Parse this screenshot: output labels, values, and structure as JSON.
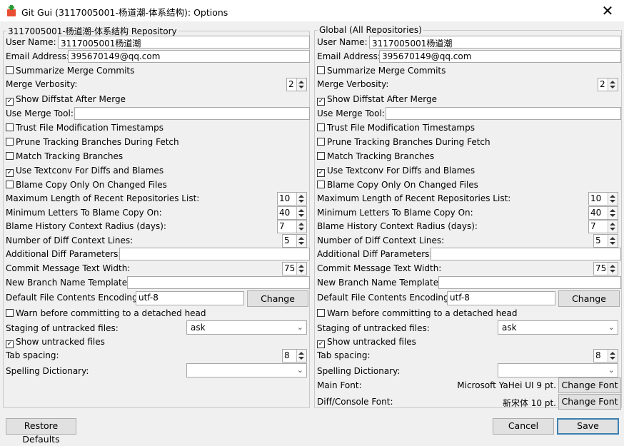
{
  "window": {
    "title": "Git Gui (3117005001-杨道潮-体系结构): Options",
    "close_glyph": "✕"
  },
  "local": {
    "legend": "3117005001-杨道潮-体系结构 Repository",
    "user_name_label": "User Name:",
    "user_name": "3117005001杨道潮",
    "email_label": "Email Address:",
    "email": "395670149@qq.com",
    "summarize_merge": "Summarize Merge Commits",
    "summarize_merge_checked": false,
    "merge_verbosity_label": "Merge Verbosity:",
    "merge_verbosity": "2",
    "show_diffstat": "Show Diffstat After Merge",
    "show_diffstat_checked": true,
    "merge_tool_label": "Use Merge Tool:",
    "merge_tool": "",
    "trust_mtime": "Trust File Modification Timestamps",
    "trust_mtime_checked": false,
    "prune_fetch": "Prune Tracking Branches During Fetch",
    "prune_fetch_checked": false,
    "match_tracking": "Match Tracking Branches",
    "match_tracking_checked": false,
    "textconv": "Use Textconv For Diffs and Blames",
    "textconv_checked": true,
    "blame_copy_changed": "Blame Copy Only On Changed Files",
    "blame_copy_changed_checked": false,
    "max_recent_label": "Maximum Length of Recent Repositories List:",
    "max_recent": "10",
    "min_blame_label": "Minimum Letters To Blame Copy On:",
    "min_blame": "40",
    "blame_radius_label": "Blame History Context Radius (days):",
    "blame_radius": "7",
    "diff_context_label": "Number of Diff Context Lines:",
    "diff_context": "5",
    "diff_params_label": "Additional Diff Parameters:",
    "diff_params": "",
    "commit_width_label": "Commit Message Text Width:",
    "commit_width": "75",
    "branch_template_label": "New Branch Name Template:",
    "branch_template": "",
    "encoding_label": "Default File Contents Encoding:",
    "encoding": "utf-8",
    "change_label": "Change",
    "warn_detached": "Warn before committing to a detached head",
    "warn_detached_checked": false,
    "staging_label": "Staging of untracked files:",
    "staging": "ask",
    "show_untracked": "Show untracked files",
    "show_untracked_checked": true,
    "tab_spacing_label": "Tab spacing:",
    "tab_spacing": "8",
    "spelling_label": "Spelling Dictionary:",
    "spelling": ""
  },
  "global": {
    "legend": "Global (All Repositories)",
    "user_name_label": "User Name:",
    "user_name": "3117005001杨道潮",
    "email_label": "Email Address:",
    "email": "395670149@qq.com",
    "summarize_merge": "Summarize Merge Commits",
    "summarize_merge_checked": false,
    "merge_verbosity_label": "Merge Verbosity:",
    "merge_verbosity": "2",
    "show_diffstat": "Show Diffstat After Merge",
    "show_diffstat_checked": true,
    "merge_tool_label": "Use Merge Tool:",
    "merge_tool": "",
    "trust_mtime": "Trust File Modification Timestamps",
    "trust_mtime_checked": false,
    "prune_fetch": "Prune Tracking Branches During Fetch",
    "prune_fetch_checked": false,
    "match_tracking": "Match Tracking Branches",
    "match_tracking_checked": false,
    "textconv": "Use Textconv For Diffs and Blames",
    "textconv_checked": true,
    "blame_copy_changed": "Blame Copy Only On Changed Files",
    "blame_copy_changed_checked": false,
    "max_recent_label": "Maximum Length of Recent Repositories List:",
    "max_recent": "10",
    "min_blame_label": "Minimum Letters To Blame Copy On:",
    "min_blame": "40",
    "blame_radius_label": "Blame History Context Radius (days):",
    "blame_radius": "7",
    "diff_context_label": "Number of Diff Context Lines:",
    "diff_context": "5",
    "diff_params_label": "Additional Diff Parameters:",
    "diff_params": "",
    "commit_width_label": "Commit Message Text Width:",
    "commit_width": "75",
    "branch_template_label": "New Branch Name Template:",
    "branch_template": "",
    "encoding_label": "Default File Contents Encoding:",
    "encoding": "utf-8",
    "change_label": "Change",
    "warn_detached": "Warn before committing to a detached head",
    "warn_detached_checked": false,
    "staging_label": "Staging of untracked files:",
    "staging": "ask",
    "show_untracked": "Show untracked files",
    "show_untracked_checked": true,
    "tab_spacing_label": "Tab spacing:",
    "tab_spacing": "8",
    "spelling_label": "Spelling Dictionary:",
    "spelling": "",
    "main_font_label": "Main Font:",
    "main_font": "Microsoft YaHei UI 9 pt.",
    "diff_font_label": "Diff/Console Font:",
    "diff_font": "新宋体 10 pt.",
    "change_font_label": "Change Font"
  },
  "footer": {
    "restore": "Restore Defaults",
    "cancel": "Cancel",
    "save": "Save"
  },
  "icons": {
    "check": "✓",
    "chevron": "⌄"
  },
  "colors": {
    "default_button_border": "#3c7fb1",
    "titlebar": "#ffffff",
    "window_bg": "#f0f0f0"
  }
}
